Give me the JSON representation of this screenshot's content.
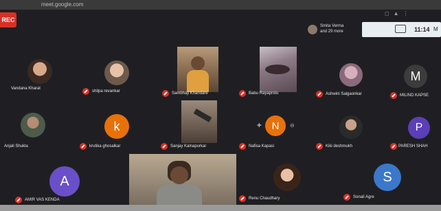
{
  "browser": {
    "url": "meet.google.com"
  },
  "recording_badge": "REC",
  "top_right": {
    "participants_text": "Smita Verma\nand 29 more",
    "status_left": "",
    "status_badge": "",
    "time": "11:14",
    "status_right": "M"
  },
  "participants": [
    {
      "name": "Vandana Kharat",
      "type": "photo"
    },
    {
      "name": "shilpa revankar",
      "type": "photo"
    },
    {
      "name": "Sambhaji Khandare",
      "type": "video"
    },
    {
      "name": "Babu Rayaprolu",
      "type": "video"
    },
    {
      "name": "Ashwini Salgaonkar",
      "type": "photo"
    },
    {
      "name": "MILIND KAPSE",
      "type": "letter",
      "letter": "M"
    },
    {
      "name": "Anjali Shukla",
      "type": "photo"
    },
    {
      "name": "krutika ghosalkar",
      "type": "letter",
      "letter": "k"
    },
    {
      "name": "Sanjay Kalnapurkar",
      "type": "video"
    },
    {
      "name": "Nafisa Kapasi",
      "type": "letter",
      "letter": "N"
    },
    {
      "name": "Kiki deshmukh",
      "type": "photo"
    },
    {
      "name": "PARESH SHAH",
      "type": "letter",
      "letter": "P"
    },
    {
      "name": "AMIR VAS KENDA",
      "type": "letter",
      "letter": "A"
    },
    {
      "name": "",
      "type": "video"
    },
    {
      "name": "Renu Chaudhary",
      "type": "photo"
    },
    {
      "name": "Sonali Agre",
      "type": "letter",
      "letter": "S"
    }
  ],
  "colors": {
    "meeting_bg": "#1f1f23",
    "mute_red": "#d93025",
    "letter_orange": "#e8710a",
    "letter_purple": "#5b3fb8",
    "letter_violet": "#6a4fc8",
    "letter_blue": "#3b78c9",
    "letter_gray": "#3c3c3c"
  }
}
